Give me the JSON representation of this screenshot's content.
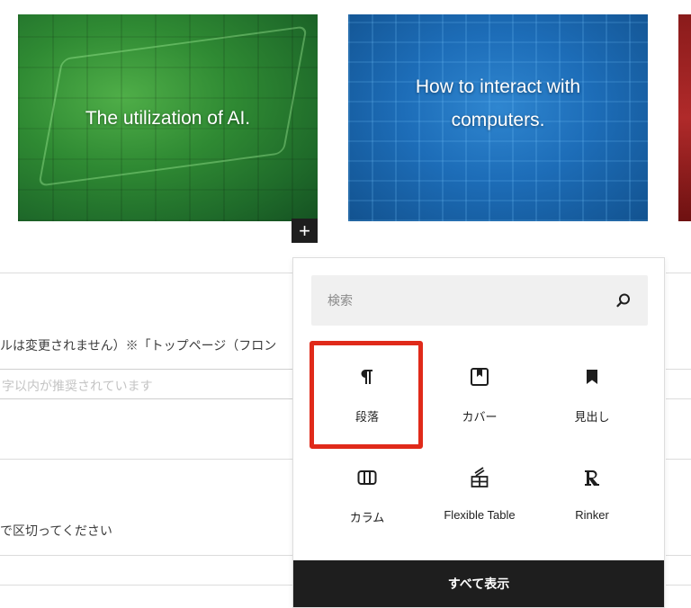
{
  "posts": [
    {
      "title": "The utilization of AI."
    },
    {
      "title": "How to interact with computers."
    }
  ],
  "inserter_button": {
    "symbol": "+"
  },
  "form": {
    "note_text": "ルは変更されません）※「トップページ（フロン",
    "placeholder_text": "字以内が推奨されています",
    "tag_hint_text": "で区切ってください"
  },
  "block_inserter": {
    "search_placeholder": "検索",
    "blocks": [
      {
        "label": "段落",
        "icon": "paragraph-icon"
      },
      {
        "label": "カバー",
        "icon": "cover-icon"
      },
      {
        "label": "見出し",
        "icon": "heading-icon"
      },
      {
        "label": "カラム",
        "icon": "columns-icon"
      },
      {
        "label": "Flexible Table",
        "icon": "table-icon"
      },
      {
        "label": "Rinker",
        "icon": "rinker-icon"
      }
    ],
    "show_all_label": "すべて表示"
  },
  "colors": {
    "highlight": "#e02a1a",
    "dark": "#1e1e1e"
  }
}
